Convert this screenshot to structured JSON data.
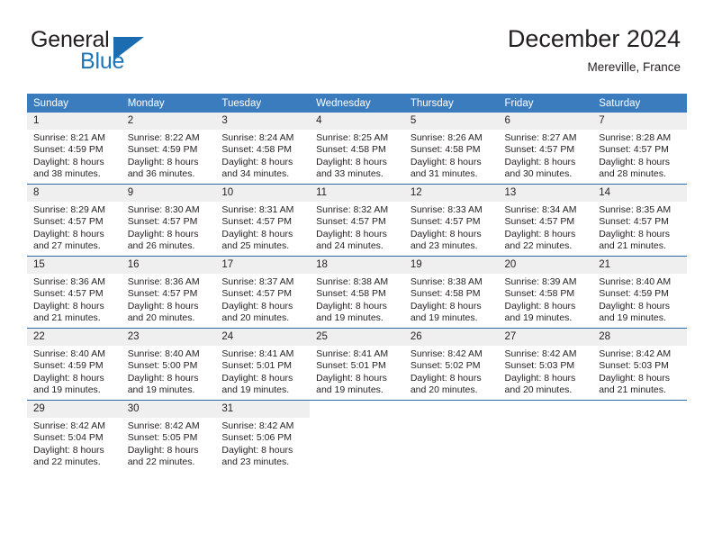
{
  "brand": {
    "name_part1": "General",
    "name_part2": "Blue",
    "logo_icon": "blue-triangle-icon"
  },
  "header": {
    "title": "December 2024",
    "subtitle": "Mereville, France"
  },
  "colors": {
    "header_blue": "#3b7cbf",
    "divider_blue": "#2b6aa8",
    "daynum_band": "#efefef",
    "brand_blue": "#1b75bb",
    "text": "#231f20"
  },
  "weekday_headers": [
    "Sunday",
    "Monday",
    "Tuesday",
    "Wednesday",
    "Thursday",
    "Friday",
    "Saturday"
  ],
  "weeks": [
    [
      {
        "day": "1",
        "sunrise": "Sunrise: 8:21 AM",
        "sunset": "Sunset: 4:59 PM",
        "daylight1": "Daylight: 8 hours",
        "daylight2": "and 38 minutes."
      },
      {
        "day": "2",
        "sunrise": "Sunrise: 8:22 AM",
        "sunset": "Sunset: 4:59 PM",
        "daylight1": "Daylight: 8 hours",
        "daylight2": "and 36 minutes."
      },
      {
        "day": "3",
        "sunrise": "Sunrise: 8:24 AM",
        "sunset": "Sunset: 4:58 PM",
        "daylight1": "Daylight: 8 hours",
        "daylight2": "and 34 minutes."
      },
      {
        "day": "4",
        "sunrise": "Sunrise: 8:25 AM",
        "sunset": "Sunset: 4:58 PM",
        "daylight1": "Daylight: 8 hours",
        "daylight2": "and 33 minutes."
      },
      {
        "day": "5",
        "sunrise": "Sunrise: 8:26 AM",
        "sunset": "Sunset: 4:58 PM",
        "daylight1": "Daylight: 8 hours",
        "daylight2": "and 31 minutes."
      },
      {
        "day": "6",
        "sunrise": "Sunrise: 8:27 AM",
        "sunset": "Sunset: 4:57 PM",
        "daylight1": "Daylight: 8 hours",
        "daylight2": "and 30 minutes."
      },
      {
        "day": "7",
        "sunrise": "Sunrise: 8:28 AM",
        "sunset": "Sunset: 4:57 PM",
        "daylight1": "Daylight: 8 hours",
        "daylight2": "and 28 minutes."
      }
    ],
    [
      {
        "day": "8",
        "sunrise": "Sunrise: 8:29 AM",
        "sunset": "Sunset: 4:57 PM",
        "daylight1": "Daylight: 8 hours",
        "daylight2": "and 27 minutes."
      },
      {
        "day": "9",
        "sunrise": "Sunrise: 8:30 AM",
        "sunset": "Sunset: 4:57 PM",
        "daylight1": "Daylight: 8 hours",
        "daylight2": "and 26 minutes."
      },
      {
        "day": "10",
        "sunrise": "Sunrise: 8:31 AM",
        "sunset": "Sunset: 4:57 PM",
        "daylight1": "Daylight: 8 hours",
        "daylight2": "and 25 minutes."
      },
      {
        "day": "11",
        "sunrise": "Sunrise: 8:32 AM",
        "sunset": "Sunset: 4:57 PM",
        "daylight1": "Daylight: 8 hours",
        "daylight2": "and 24 minutes."
      },
      {
        "day": "12",
        "sunrise": "Sunrise: 8:33 AM",
        "sunset": "Sunset: 4:57 PM",
        "daylight1": "Daylight: 8 hours",
        "daylight2": "and 23 minutes."
      },
      {
        "day": "13",
        "sunrise": "Sunrise: 8:34 AM",
        "sunset": "Sunset: 4:57 PM",
        "daylight1": "Daylight: 8 hours",
        "daylight2": "and 22 minutes."
      },
      {
        "day": "14",
        "sunrise": "Sunrise: 8:35 AM",
        "sunset": "Sunset: 4:57 PM",
        "daylight1": "Daylight: 8 hours",
        "daylight2": "and 21 minutes."
      }
    ],
    [
      {
        "day": "15",
        "sunrise": "Sunrise: 8:36 AM",
        "sunset": "Sunset: 4:57 PM",
        "daylight1": "Daylight: 8 hours",
        "daylight2": "and 21 minutes."
      },
      {
        "day": "16",
        "sunrise": "Sunrise: 8:36 AM",
        "sunset": "Sunset: 4:57 PM",
        "daylight1": "Daylight: 8 hours",
        "daylight2": "and 20 minutes."
      },
      {
        "day": "17",
        "sunrise": "Sunrise: 8:37 AM",
        "sunset": "Sunset: 4:57 PM",
        "daylight1": "Daylight: 8 hours",
        "daylight2": "and 20 minutes."
      },
      {
        "day": "18",
        "sunrise": "Sunrise: 8:38 AM",
        "sunset": "Sunset: 4:58 PM",
        "daylight1": "Daylight: 8 hours",
        "daylight2": "and 19 minutes."
      },
      {
        "day": "19",
        "sunrise": "Sunrise: 8:38 AM",
        "sunset": "Sunset: 4:58 PM",
        "daylight1": "Daylight: 8 hours",
        "daylight2": "and 19 minutes."
      },
      {
        "day": "20",
        "sunrise": "Sunrise: 8:39 AM",
        "sunset": "Sunset: 4:58 PM",
        "daylight1": "Daylight: 8 hours",
        "daylight2": "and 19 minutes."
      },
      {
        "day": "21",
        "sunrise": "Sunrise: 8:40 AM",
        "sunset": "Sunset: 4:59 PM",
        "daylight1": "Daylight: 8 hours",
        "daylight2": "and 19 minutes."
      }
    ],
    [
      {
        "day": "22",
        "sunrise": "Sunrise: 8:40 AM",
        "sunset": "Sunset: 4:59 PM",
        "daylight1": "Daylight: 8 hours",
        "daylight2": "and 19 minutes."
      },
      {
        "day": "23",
        "sunrise": "Sunrise: 8:40 AM",
        "sunset": "Sunset: 5:00 PM",
        "daylight1": "Daylight: 8 hours",
        "daylight2": "and 19 minutes."
      },
      {
        "day": "24",
        "sunrise": "Sunrise: 8:41 AM",
        "sunset": "Sunset: 5:01 PM",
        "daylight1": "Daylight: 8 hours",
        "daylight2": "and 19 minutes."
      },
      {
        "day": "25",
        "sunrise": "Sunrise: 8:41 AM",
        "sunset": "Sunset: 5:01 PM",
        "daylight1": "Daylight: 8 hours",
        "daylight2": "and 19 minutes."
      },
      {
        "day": "26",
        "sunrise": "Sunrise: 8:42 AM",
        "sunset": "Sunset: 5:02 PM",
        "daylight1": "Daylight: 8 hours",
        "daylight2": "and 20 minutes."
      },
      {
        "day": "27",
        "sunrise": "Sunrise: 8:42 AM",
        "sunset": "Sunset: 5:03 PM",
        "daylight1": "Daylight: 8 hours",
        "daylight2": "and 20 minutes."
      },
      {
        "day": "28",
        "sunrise": "Sunrise: 8:42 AM",
        "sunset": "Sunset: 5:03 PM",
        "daylight1": "Daylight: 8 hours",
        "daylight2": "and 21 minutes."
      }
    ],
    [
      {
        "day": "29",
        "sunrise": "Sunrise: 8:42 AM",
        "sunset": "Sunset: 5:04 PM",
        "daylight1": "Daylight: 8 hours",
        "daylight2": "and 22 minutes."
      },
      {
        "day": "30",
        "sunrise": "Sunrise: 8:42 AM",
        "sunset": "Sunset: 5:05 PM",
        "daylight1": "Daylight: 8 hours",
        "daylight2": "and 22 minutes."
      },
      {
        "day": "31",
        "sunrise": "Sunrise: 8:42 AM",
        "sunset": "Sunset: 5:06 PM",
        "daylight1": "Daylight: 8 hours",
        "daylight2": "and 23 minutes."
      },
      {
        "day": "",
        "sunrise": "",
        "sunset": "",
        "daylight1": "",
        "daylight2": ""
      },
      {
        "day": "",
        "sunrise": "",
        "sunset": "",
        "daylight1": "",
        "daylight2": ""
      },
      {
        "day": "",
        "sunrise": "",
        "sunset": "",
        "daylight1": "",
        "daylight2": ""
      },
      {
        "day": "",
        "sunrise": "",
        "sunset": "",
        "daylight1": "",
        "daylight2": ""
      }
    ]
  ]
}
